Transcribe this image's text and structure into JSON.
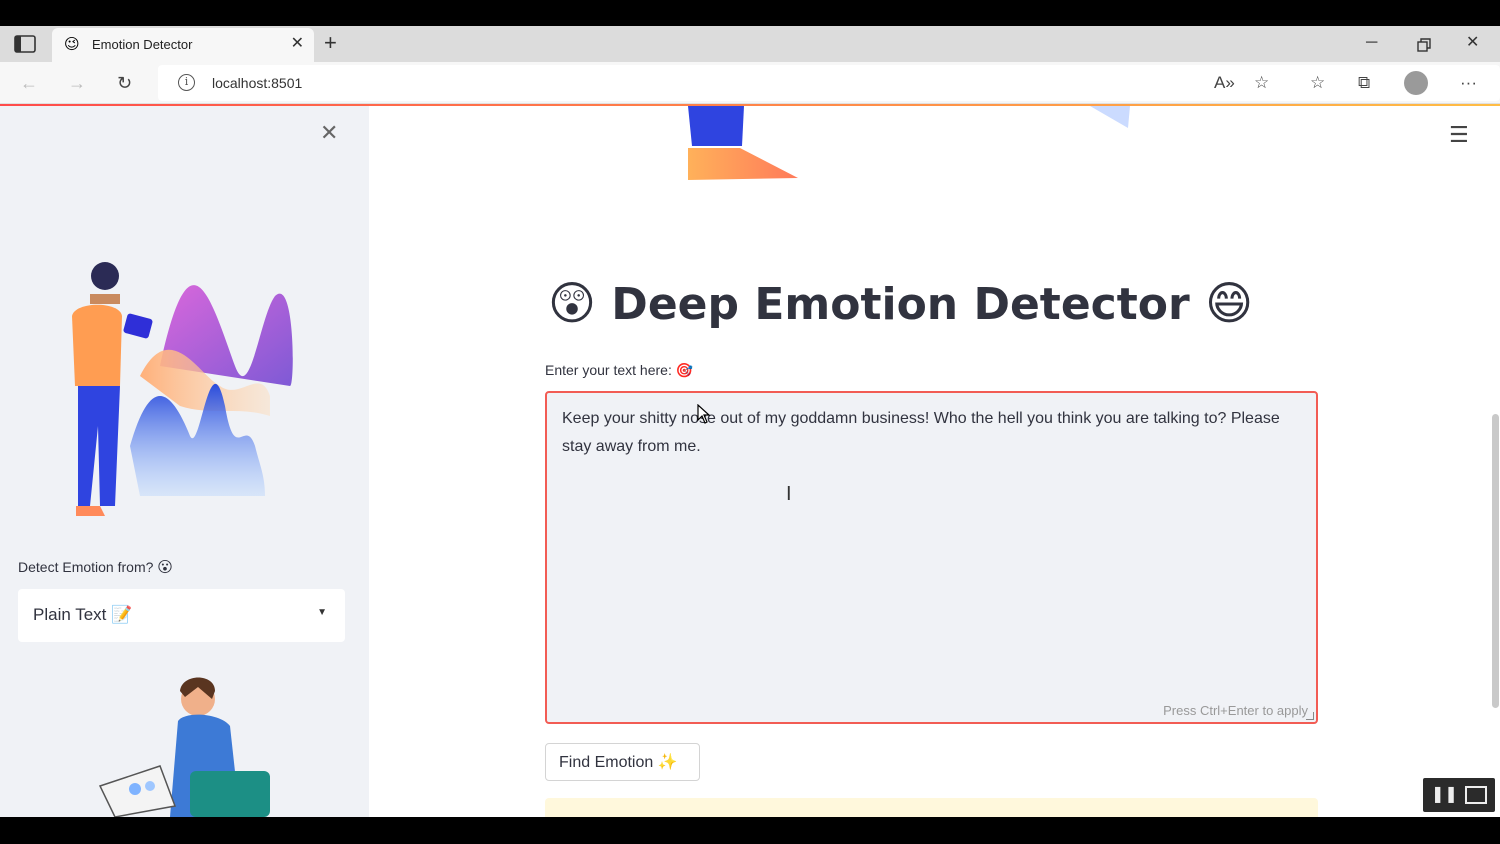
{
  "browser": {
    "tab_title": "Emotion Detector",
    "tab_favicon": "😉",
    "url": "localhost:8501"
  },
  "sidebar": {
    "select_label": "Detect Emotion from?",
    "select_label_emoji": "😮",
    "select_value": "Plain Text 📝"
  },
  "main": {
    "title": "Deep Emotion Detector",
    "title_emoji_left": "😲",
    "title_emoji_right": "😄",
    "input_label": "Enter your text here:",
    "input_label_emoji": "🎯",
    "input_value": "Keep your shitty nose out of my goddamn business! Who the hell you think you are talking to? Please stay away from me.",
    "input_hint": "Press Ctrl+Enter to apply",
    "button_label": "Find Emotion ✨"
  },
  "colors": {
    "accent": "#ff4b4b",
    "sidebar_bg": "#f0f2f6",
    "text": "#31333f"
  },
  "icons": [
    "tab-actions-icon",
    "close-icon",
    "plus-icon",
    "minimize-icon",
    "restore-icon",
    "back-icon",
    "forward-icon",
    "refresh-icon",
    "info-icon",
    "read-aloud-icon",
    "add-favorite-icon",
    "favorites-icon",
    "collections-icon",
    "profile-icon",
    "more-icon",
    "hamburger-icon",
    "pause-icon",
    "pip-icon"
  ]
}
